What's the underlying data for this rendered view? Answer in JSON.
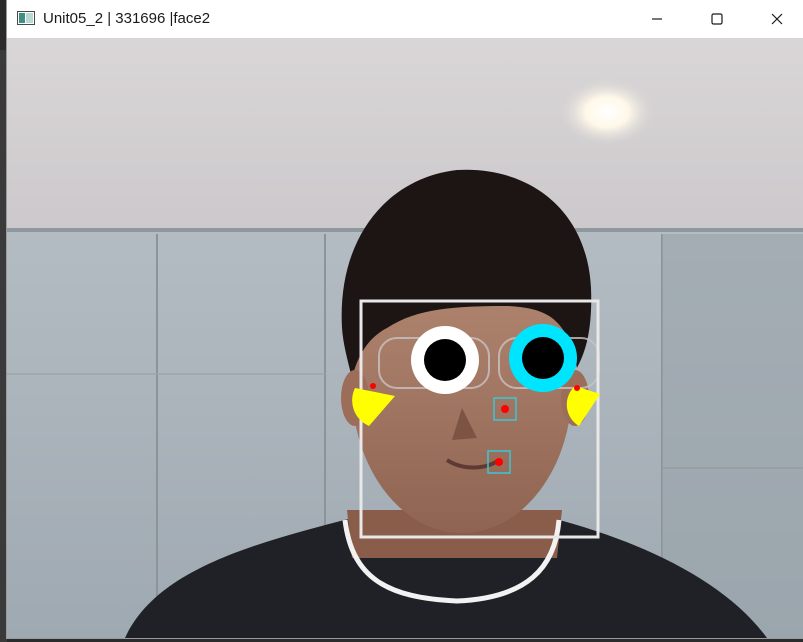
{
  "window": {
    "title": "Unit05_2 | 331696 |face2",
    "icon": "opencv-window-icon",
    "controls": [
      "minimize-icon",
      "maximize-icon",
      "close-icon"
    ]
  },
  "overlay": {
    "face_box_color": "#e8e8e8",
    "left_eye_color": "#ffffff",
    "right_eye_color": "#00e5ff",
    "pupil_color": "#000000",
    "cheek_color": "#ffff00",
    "marker_color": "#ff0000",
    "marker_box_color": "#39c7d6"
  }
}
